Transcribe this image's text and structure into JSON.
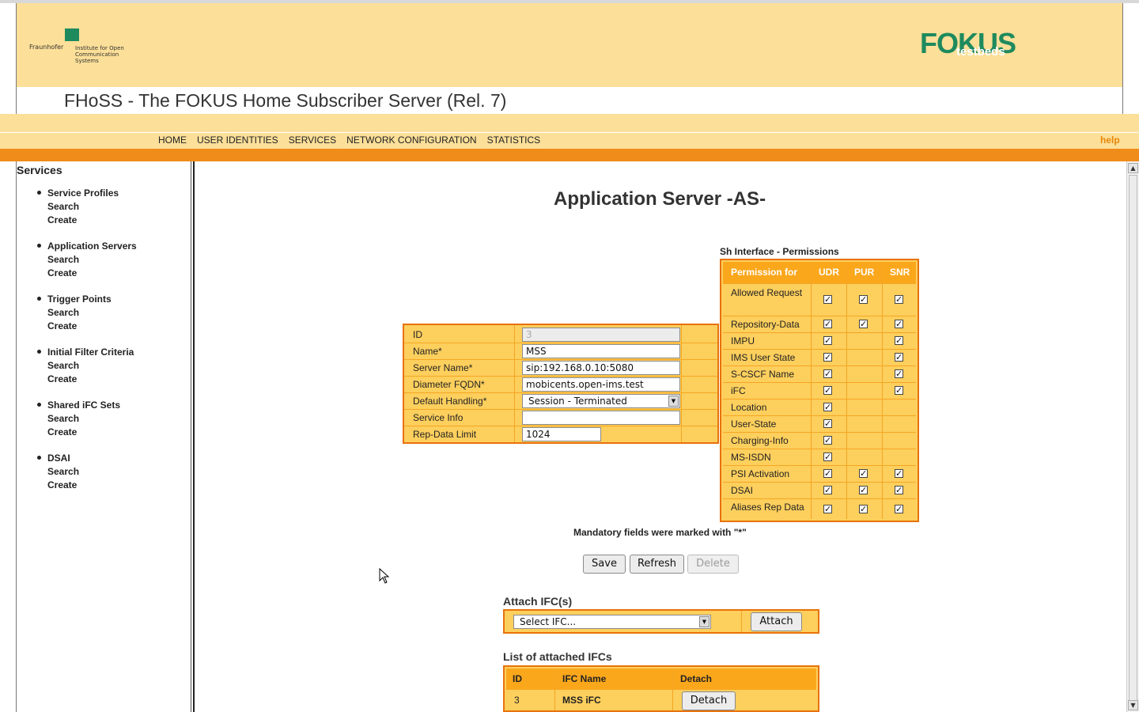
{
  "header": {
    "fraunhofer_word": "Fraunhofer",
    "fraunhofer_institute": "Institute for Open Communication Systems",
    "fraunhofer_badge": "FOKUS",
    "fokus_logo_main": "FOKUS",
    "fokus_logo_sub": "testbeds",
    "app_title": "FHoSS - The FOKUS Home Subscriber Server (Rel. 7)"
  },
  "nav": {
    "items": [
      "HOME",
      "USER IDENTITIES",
      "SERVICES",
      "NETWORK CONFIGURATION",
      "STATISTICS"
    ],
    "help": "help"
  },
  "sidebar": {
    "title": "Services",
    "groups": [
      {
        "label": "Service Profiles",
        "search": "Search",
        "create": "Create"
      },
      {
        "label": "Application Servers",
        "search": "Search",
        "create": "Create"
      },
      {
        "label": "Trigger Points",
        "search": "Search",
        "create": "Create"
      },
      {
        "label": "Initial Filter Criteria",
        "search": "Search",
        "create": "Create"
      },
      {
        "label": "Shared iFC Sets",
        "search": "Search",
        "create": "Create"
      },
      {
        "label": "DSAI",
        "search": "Search",
        "create": "Create"
      }
    ]
  },
  "main": {
    "page_title": "Application Server -AS-",
    "form": {
      "id_label": "ID",
      "id_value": "3",
      "name_label": "Name*",
      "name_value": "MSS",
      "server_name_label": "Server Name*",
      "server_name_value": "sip:192.168.0.10:5080",
      "diameter_label": "Diameter FQDN*",
      "diameter_value": "mobicents.open-ims.test",
      "default_handling_label": "Default Handling*",
      "default_handling_value": "Session - Terminated",
      "service_info_label": "Service Info",
      "service_info_value": "",
      "rep_data_label": "Rep-Data Limit",
      "rep_data_value": "1024"
    },
    "mandatory_note": "Mandatory fields were marked with \"*\"",
    "buttons": {
      "save": "Save",
      "refresh": "Refresh",
      "delete": "Delete"
    },
    "sh": {
      "title": "Sh Interface - Permissions",
      "headers": [
        "Permission for",
        "UDR",
        "PUR",
        "SNR"
      ],
      "rows": [
        {
          "name": "Allowed Request",
          "udr": true,
          "pur": true,
          "snr": true
        },
        {
          "name": "Repository-Data",
          "udr": true,
          "pur": true,
          "snr": true
        },
        {
          "name": "IMPU",
          "udr": true,
          "pur": false,
          "snr": true
        },
        {
          "name": "IMS User State",
          "udr": true,
          "pur": false,
          "snr": true
        },
        {
          "name": "S-CSCF Name",
          "udr": true,
          "pur": false,
          "snr": true
        },
        {
          "name": "iFC",
          "udr": true,
          "pur": false,
          "snr": true
        },
        {
          "name": "Location",
          "udr": true,
          "pur": false,
          "snr": false
        },
        {
          "name": "User-State",
          "udr": true,
          "pur": false,
          "snr": false
        },
        {
          "name": "Charging-Info",
          "udr": true,
          "pur": false,
          "snr": false
        },
        {
          "name": "MS-ISDN",
          "udr": true,
          "pur": false,
          "snr": false
        },
        {
          "name": "PSI Activation",
          "udr": true,
          "pur": true,
          "snr": true
        },
        {
          "name": "DSAI",
          "udr": true,
          "pur": true,
          "snr": true
        },
        {
          "name": "Aliases Rep Data",
          "udr": true,
          "pur": true,
          "snr": true
        }
      ]
    },
    "attach": {
      "title": "Attach IFC(s)",
      "select_value": "Select IFC...",
      "button": "Attach"
    },
    "attached_list": {
      "title": "List of attached IFCs",
      "headers": [
        "ID",
        "IFC Name",
        "Detach"
      ],
      "rows": [
        {
          "id": "3",
          "name": "MSS iFC",
          "action": "Detach"
        }
      ]
    }
  },
  "colors": {
    "banner": "#fcdf98",
    "orange_bar": "#f08c1a",
    "table_bg": "#fdcf5d",
    "table_border": "#e8720c",
    "header_cell": "#fba71c",
    "help_link": "#e8860a",
    "logo_green": "#1e8a5e"
  }
}
